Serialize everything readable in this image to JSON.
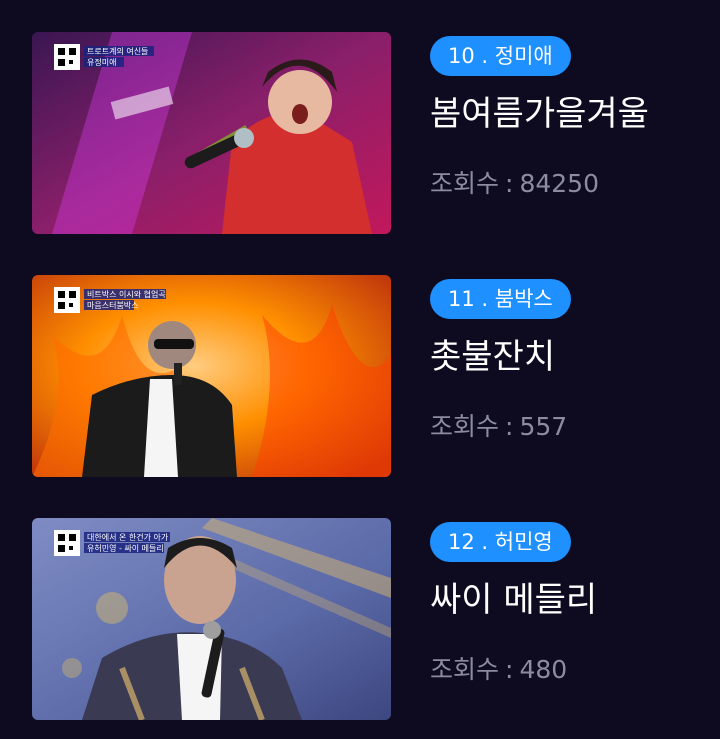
{
  "items": [
    {
      "rank_label": "10 . 정미애",
      "song_title": "봄여름가을겨울",
      "views_label": "조회수",
      "views_count": "84250",
      "overlay_text": [
        "트로트계의 여신들",
        "유정미애"
      ],
      "thumbnail_icon": "qr-code-icon",
      "colors": {
        "primary": "#8a1f6a",
        "secondary": "#c2185b",
        "accent": "#e53935"
      }
    },
    {
      "rank_label": "11 . 붐박스",
      "song_title": "촛불잔치",
      "views_label": "조회수",
      "views_count": "557",
      "overlay_text": [
        "비트박스 이시와 협업곡",
        "마음스터붐박스"
      ],
      "thumbnail_icon": "qr-code-icon",
      "colors": {
        "primary": "#e65100",
        "secondary": "#ff8f00",
        "accent": "#bf360c"
      }
    },
    {
      "rank_label": "12 . 허민영",
      "song_title": "싸이 메들리",
      "views_label": "조회수",
      "views_count": "480",
      "overlay_text": [
        "대한에서 온 한건가 아가",
        "유허민영 - 싸이 메들리"
      ],
      "thumbnail_icon": "qr-code-icon",
      "colors": {
        "primary": "#5b6aa8",
        "secondary": "#d7b56d",
        "accent": "#3a3a52"
      }
    }
  ],
  "colors": {
    "background": "#0e0b21",
    "badge": "#1e90ff",
    "title": "#ffffff",
    "views": "#8d8c9e"
  }
}
